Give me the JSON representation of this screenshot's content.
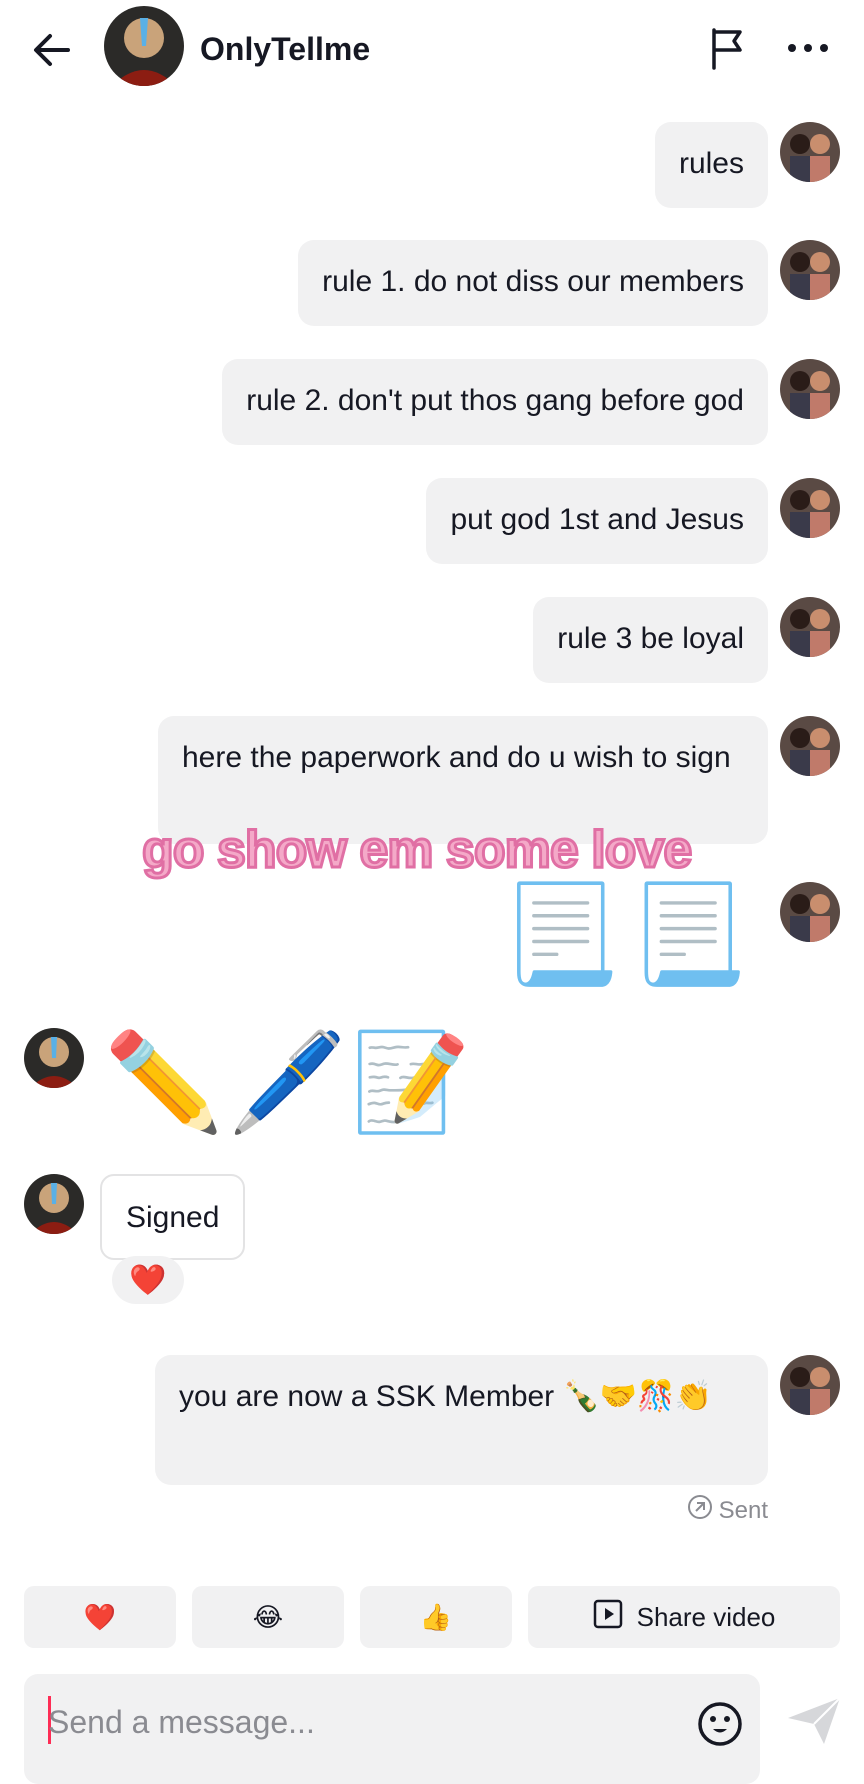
{
  "header": {
    "username": "OnlyTellme"
  },
  "messages": {
    "m1": "rules",
    "m2": "rule 1. do not diss our members",
    "m3": "rule 2. don't put thos gang before god",
    "m4": "put god 1st and Jesus",
    "m5": "rule 3 be loyal",
    "m6": "here the paperwork and do u wish to sign",
    "m7_emoji": "📃📃",
    "m8_emoji": "✏️🖊️📝",
    "m9": "Signed",
    "m9_reaction": "❤️",
    "m10": "you are now a SSK Member 🍾🤝🎊👏"
  },
  "overlay_text": "go show em some love",
  "status": {
    "sent": "Sent"
  },
  "quick_replies": {
    "heart": "❤️",
    "laugh": "😂",
    "thumbs": "👍",
    "share_video": "Share video"
  },
  "composer": {
    "placeholder": "Send a message..."
  },
  "colors": {
    "bubble_bg": "#f1f1f2",
    "accent": "#fe2c55",
    "overlay_fill": "#f4a9c8",
    "overlay_stroke": "#e06fa4"
  },
  "icons": [
    "back-arrow-icon",
    "flag-icon",
    "more-icon",
    "emoji-icon",
    "send-icon",
    "play-icon",
    "sent-icon"
  ]
}
